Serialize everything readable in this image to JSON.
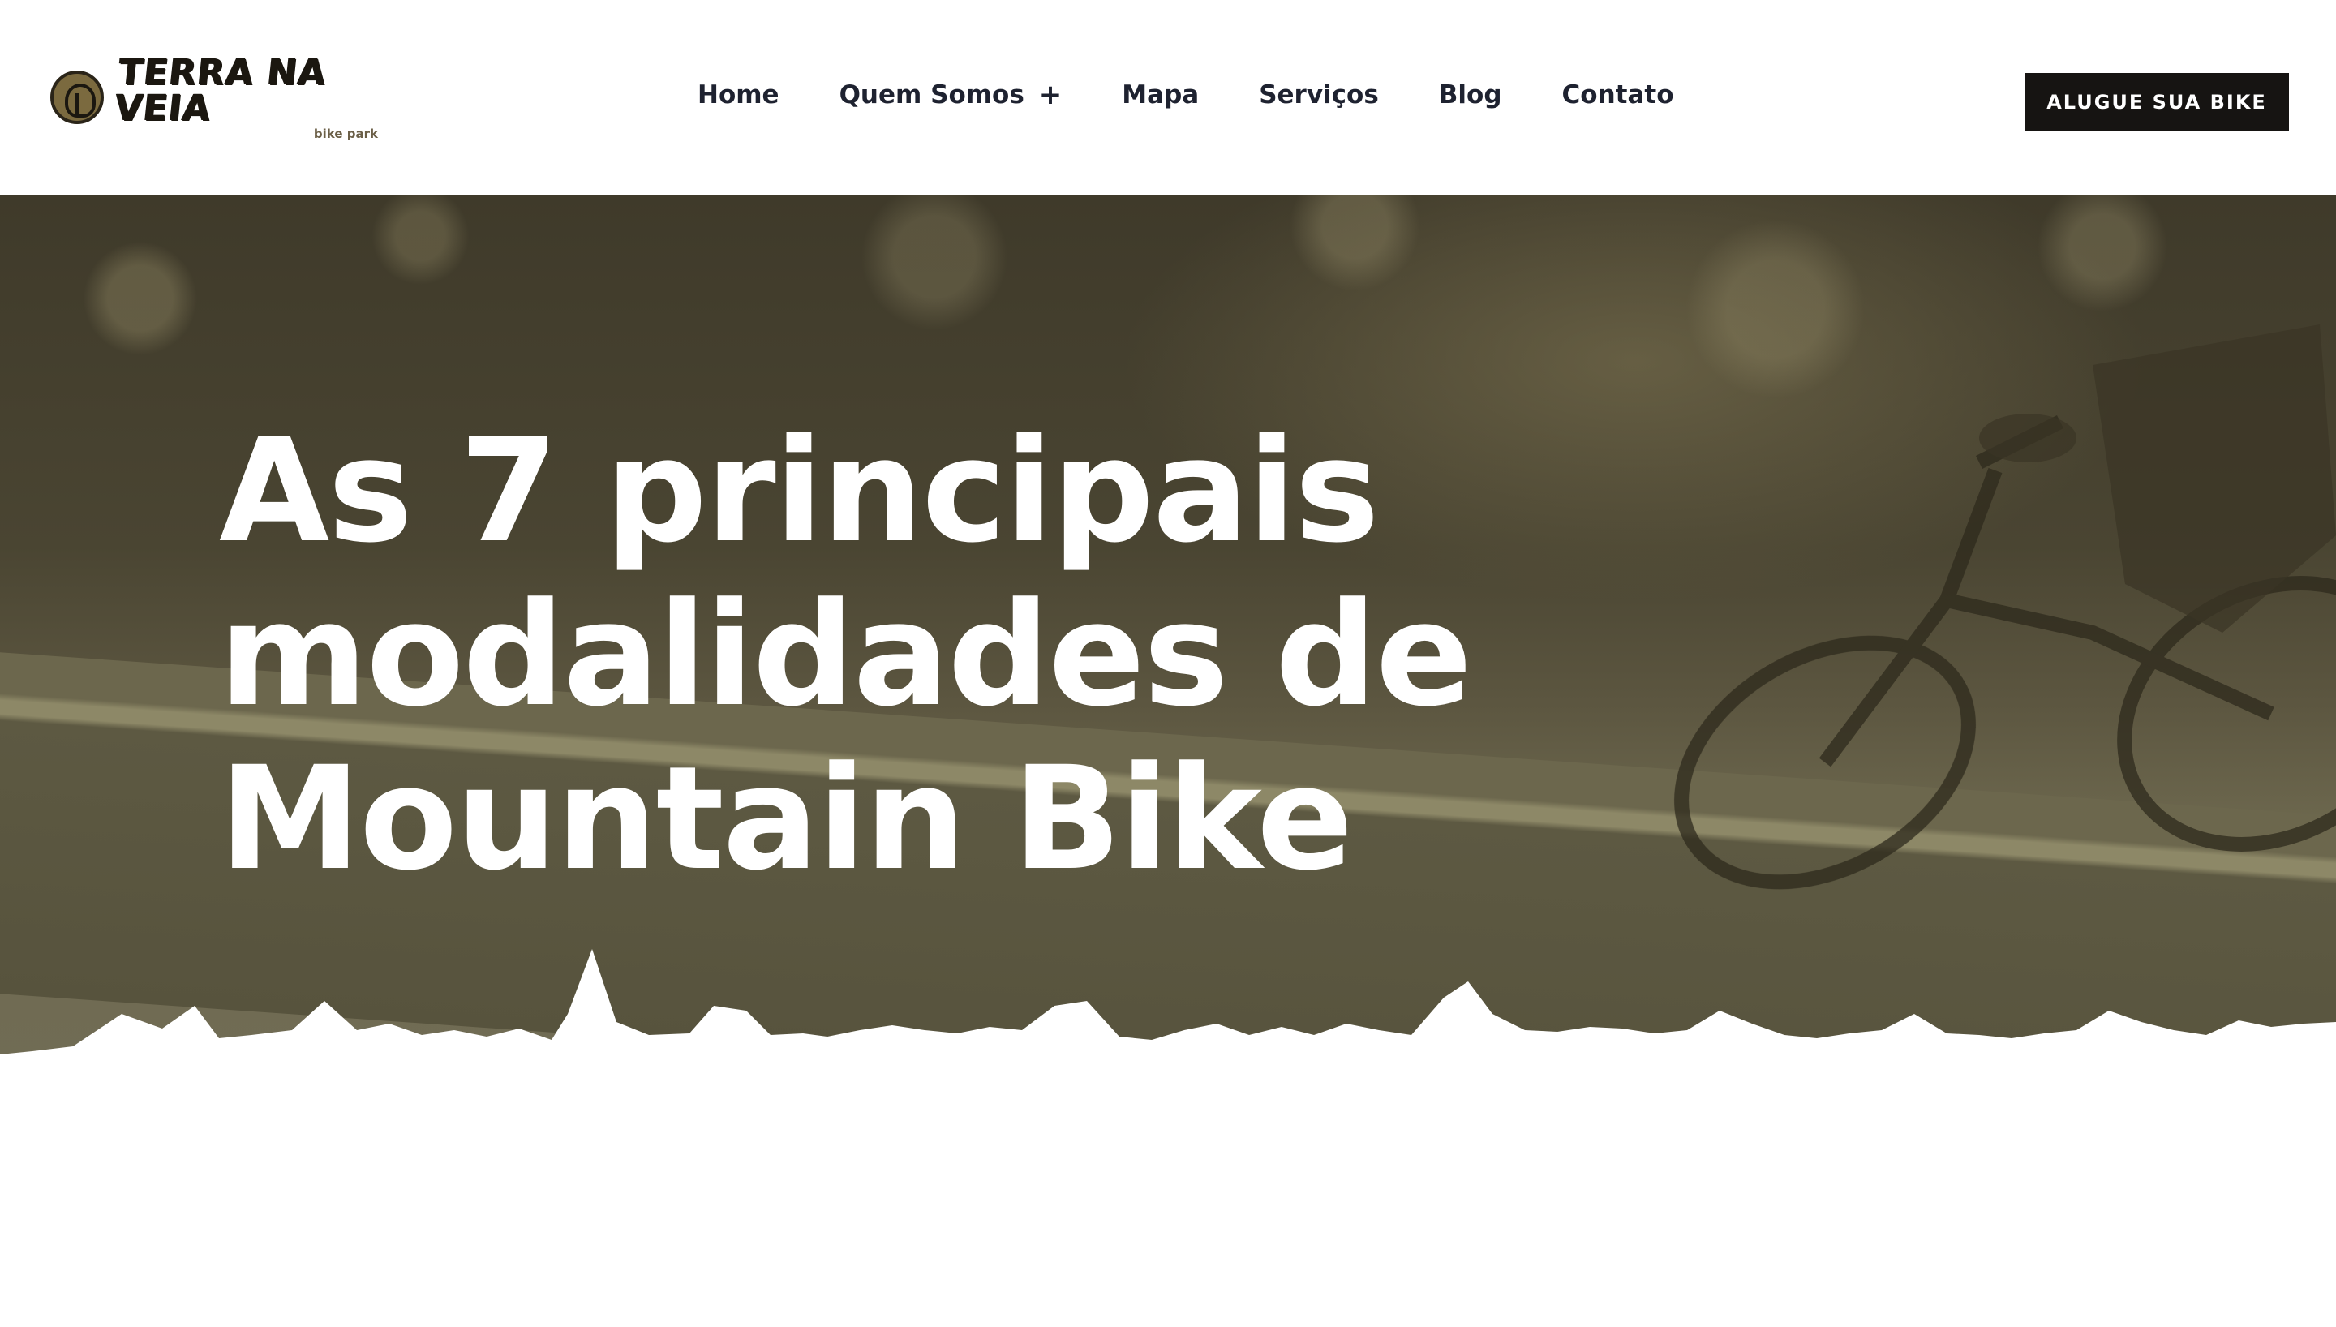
{
  "header": {
    "logo": {
      "word": "TERRA NA VEIA",
      "sub": "bike park"
    },
    "nav": [
      {
        "label": "Home"
      },
      {
        "label": "Quem Somos",
        "suffix": "+"
      },
      {
        "label": "Mapa"
      },
      {
        "label": "Serviços"
      },
      {
        "label": "Blog"
      },
      {
        "label": "Contato"
      }
    ],
    "cta_label": "ALUGUE SUA BIKE"
  },
  "hero": {
    "title": "As 7 principais modalidades de Mountain Bike"
  },
  "colors": {
    "cta_bg": "#161412",
    "nav_text": "#1e2230",
    "hero_tint": "#6f6a50",
    "hero_text": "#ffffff"
  }
}
